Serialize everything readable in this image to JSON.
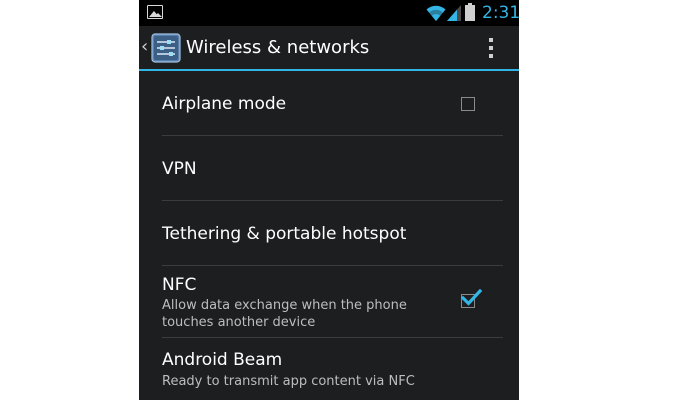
{
  "status_bar": {
    "time": "2:31",
    "icons": [
      "gallery-icon",
      "wifi-icon",
      "signal-icon",
      "battery-icon"
    ]
  },
  "action_bar": {
    "title": "Wireless & networks",
    "icons": [
      "back-chevron-icon",
      "settings-app-icon",
      "overflow-menu-icon"
    ]
  },
  "settings": {
    "items": [
      {
        "title": "Airplane mode",
        "summary": "",
        "checkbox": true,
        "checked": false
      },
      {
        "title": "VPN",
        "summary": "",
        "checkbox": false,
        "checked": false
      },
      {
        "title": "Tethering & portable hotspot",
        "summary": "",
        "checkbox": false,
        "checked": false
      },
      {
        "title": "NFC",
        "summary": "Allow data exchange when the phone touches another device",
        "checkbox": true,
        "checked": true
      },
      {
        "title": "Android Beam",
        "summary": "Ready to transmit app content via NFC",
        "checkbox": false,
        "checked": false
      }
    ]
  },
  "colors": {
    "accent": "#33b5e5",
    "background": "#1c1e20",
    "status_bar": "#000000",
    "text_primary": "#ffffff",
    "text_secondary": "#bdbdbd",
    "divider": "#3a3d40"
  }
}
